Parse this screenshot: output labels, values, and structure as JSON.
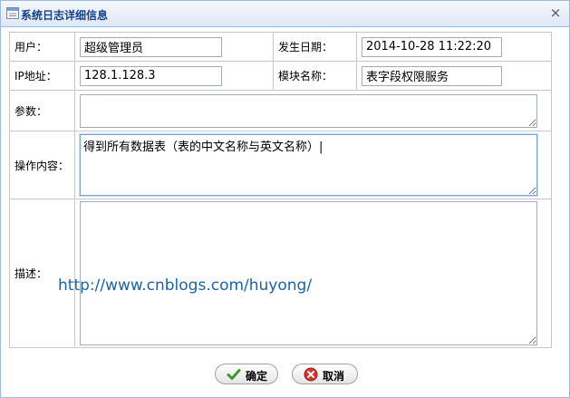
{
  "dialog": {
    "title": "系统日志详细信息"
  },
  "fields": {
    "user": {
      "label": "用户：",
      "value": "超级管理员"
    },
    "date": {
      "label": "发生日期：",
      "value": "2014-10-28 11:22:20"
    },
    "ip": {
      "label": "IP地址：",
      "value": "128.1.128.3"
    },
    "module": {
      "label": "模块名称：",
      "value": "表字段权限服务"
    },
    "params": {
      "label": "参数：",
      "value": ""
    },
    "operation": {
      "label": "操作内容：",
      "value": "得到所有数据表（表的中文名称与英文名称）|"
    },
    "description": {
      "label": "描述：",
      "value": ""
    }
  },
  "watermark": "http://www.cnblogs.com/huyong/",
  "buttons": {
    "ok": "确定",
    "cancel": "取消"
  },
  "colors": {
    "title_text": "#15428b",
    "watermark": "#1a63a8",
    "border": "#99bbe8"
  }
}
